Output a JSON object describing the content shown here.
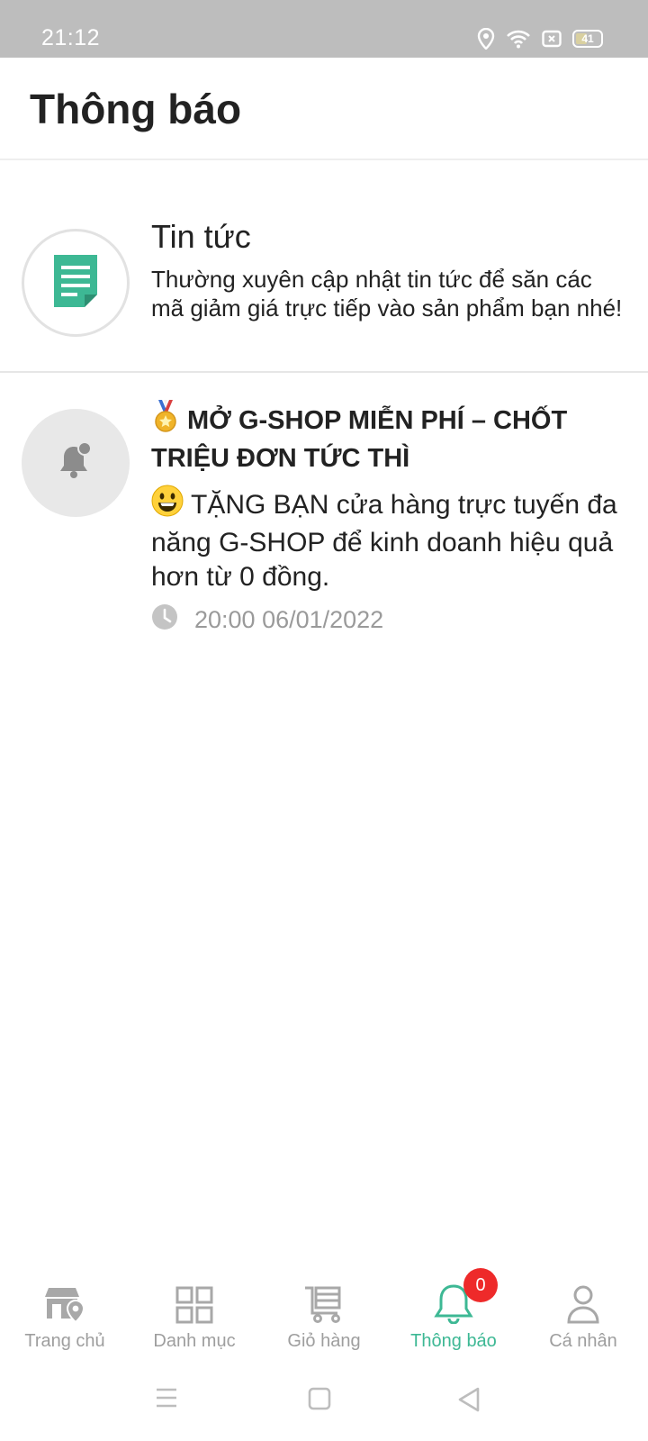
{
  "status_bar": {
    "time": "21:12",
    "battery_level": "41",
    "icons": [
      "location-icon",
      "wifi-icon",
      "sim-icon",
      "battery-icon"
    ]
  },
  "header": {
    "title": "Thông báo"
  },
  "notifications": [
    {
      "icon": "document-icon",
      "title": "Tin tức",
      "description": "Thường xuyên cập nhật tin tức để săn các mã giảm giá trực tiếp vào sản phẩm bạn nhé!"
    },
    {
      "icon": "bell-icon",
      "title_emoji": "medal-emoji",
      "title": "MỞ G-SHOP MIỄN PHÍ – CHỐT TRIỆU ĐƠN TỨC THÌ",
      "body_emoji": "smiley-emoji",
      "description": "TẶNG BẠN cửa hàng trực tuyến đa năng G-SHOP để kinh doanh hiệu quả hơn từ 0 đồng.",
      "timestamp": "20:00 06/01/2022"
    }
  ],
  "bottom_nav": {
    "items": [
      {
        "label": "Trang chủ",
        "icon": "store-location-icon",
        "active": false
      },
      {
        "label": "Danh mục",
        "icon": "grid-icon",
        "active": false
      },
      {
        "label": "Giỏ hàng",
        "icon": "cart-icon",
        "active": false
      },
      {
        "label": "Thông báo",
        "icon": "bell-icon",
        "active": true,
        "badge": "0"
      },
      {
        "label": "Cá nhân",
        "icon": "person-icon",
        "active": false
      }
    ]
  },
  "colors": {
    "accent": "#3db894",
    "badge": "#ee2a2a",
    "status_bar": "#bdbdbd",
    "inactive": "#9e9e9e"
  }
}
